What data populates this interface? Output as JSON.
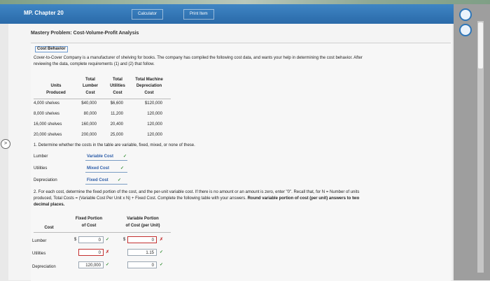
{
  "window": {
    "title": "MP. Chapter 20",
    "calculator_label": "Calculator",
    "print_label": "Print Item"
  },
  "problem_title": "Mastery Problem: Cost-Volume-Profit Analysis",
  "section_title": "Cost Behavior",
  "intro_line1": "Cover-to-Cover Company is a manufacturer of shelving for books. The company has compiled the following cost data, and wants your help in determining the cost behavior. After",
  "intro_line2": "reviewing the data, complete requirements (1) and (2) that follow.",
  "table": {
    "h1_top": "Total",
    "h1_mid": "Lumber",
    "h1_bot": "Cost",
    "h2_top": "Total",
    "h2_mid": "Utilities",
    "h2_bot": "Cost",
    "h3_top": "Total Machine",
    "h3_mid": "Depreciation",
    "h3_bot": "Cost",
    "h0_a": "Units",
    "h0_b": "Produced",
    "rows": [
      {
        "units": "4,000 shelves",
        "lumber": "$40,000",
        "utilities": "$6,600",
        "depr": "$120,000"
      },
      {
        "units": "8,000 shelves",
        "lumber": "80,000",
        "utilities": "11,200",
        "depr": "120,000"
      },
      {
        "units": "16,000 shelves",
        "lumber": "160,000",
        "utilities": "20,400",
        "depr": "120,000"
      },
      {
        "units": "20,000 shelves",
        "lumber": "200,000",
        "utilities": "25,000",
        "depr": "120,000"
      }
    ]
  },
  "q1": {
    "prompt": "1. Determine whether the costs in the table are variable, fixed, mixed, or none of these.",
    "rows": [
      {
        "label": "Lumber",
        "answer": "Variable Cost",
        "mark": "✓"
      },
      {
        "label": "Utilities",
        "answer": "Mixed Cost",
        "mark": "✓"
      },
      {
        "label": "Depreciation",
        "answer": "Fixed Cost",
        "mark": "✓"
      }
    ]
  },
  "q2": {
    "line1": "2. For each cost, determine the fixed portion of the cost, and the per-unit variable cost. If there is no amount or an amount is zero, enter \"0\". Recall that, for N = Number of units",
    "line2_a": "produced, Total Costs = (Variable Cost Per Unit x N) + Fixed Cost. Complete the following table with your answers. ",
    "line2_b": "Round variable portion of cost (per unit) answers to two",
    "line3": "decimal places.",
    "col_cost": "Cost",
    "col_fixed_a": "Fixed Portion",
    "col_fixed_b": "of Cost",
    "col_var_a": "Variable Portion",
    "col_var_b": "of Cost (per Unit)",
    "currency": "$",
    "rows": [
      {
        "label": "Lumber",
        "fixed": "0",
        "fixed_mark": "✓",
        "var": "0",
        "var_mark": "✗"
      },
      {
        "label": "Utilities",
        "fixed": "0",
        "fixed_mark": "✗",
        "var": "1.15",
        "var_mark": "✓"
      },
      {
        "label": "Depreciation",
        "fixed": "120,000",
        "fixed_mark": "✓",
        "var": "0",
        "var_mark": "✓"
      }
    ]
  },
  "colors": {
    "title_bar": "#2a6aa9",
    "check": "#2c8a2c",
    "cross": "#c43030",
    "link": "#2d5da8"
  }
}
